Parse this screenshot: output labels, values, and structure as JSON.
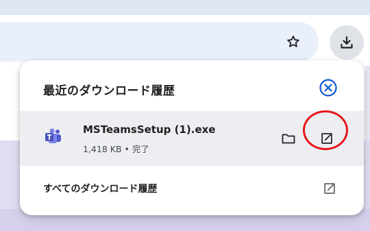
{
  "toolbar": {
    "star_icon": "bookmark-star-icon",
    "download_icon": "download-icon"
  },
  "downloads_panel": {
    "title": "最近のダウンロード履歴",
    "close_icon": "close-circle-icon",
    "items": [
      {
        "file_name": "MSTeamsSetup (1).exe",
        "size": "1,418 KB",
        "separator": "•",
        "status": "完了",
        "app_icon": "teams-icon",
        "folder_icon": "folder-icon",
        "open_icon": "open-external-icon"
      }
    ],
    "all_downloads_label": "すべてのダウンロード履歴",
    "all_downloads_icon": "open-external-icon"
  },
  "colors": {
    "accent_blue": "#0b57d0",
    "annotation_red": "#e8141b",
    "item_row_bg": "#eceef1",
    "address_bar_bg": "#eaf0fb"
  }
}
